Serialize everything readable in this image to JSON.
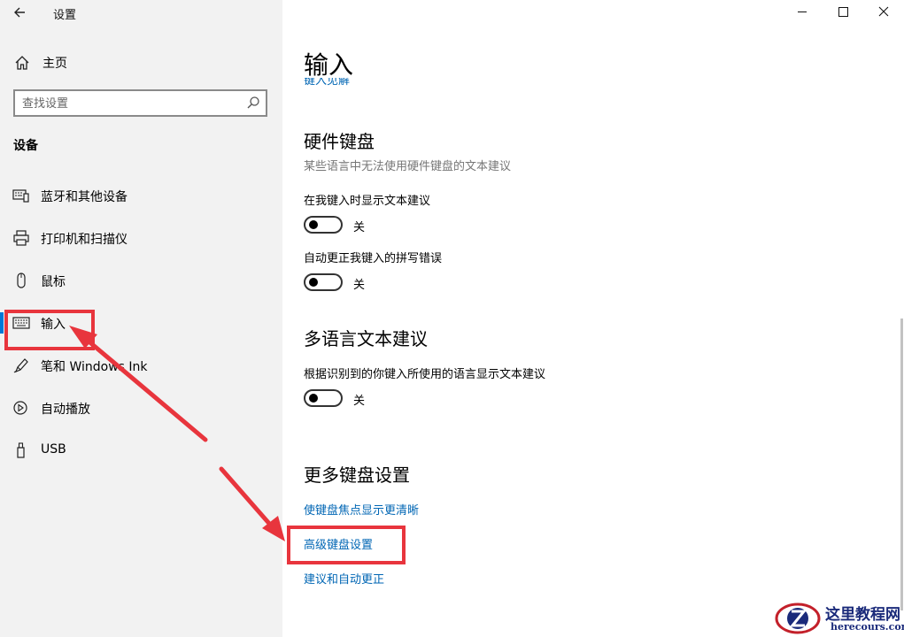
{
  "window": {
    "title": "设置",
    "controls": {
      "minimize": "minimize-icon",
      "maximize": "maximize-icon",
      "close": "close-icon"
    }
  },
  "sidebar": {
    "home_label": "主页",
    "search_placeholder": "查找设置",
    "section": "设备",
    "items": [
      {
        "label": "蓝牙和其他设备",
        "icon": "bluetooth-devices-icon"
      },
      {
        "label": "打印机和扫描仪",
        "icon": "printer-icon"
      },
      {
        "label": "鼠标",
        "icon": "mouse-icon"
      },
      {
        "label": "输入",
        "icon": "keyboard-icon",
        "active": true
      },
      {
        "label": "笔和 Windows Ink",
        "icon": "pen-icon"
      },
      {
        "label": "自动播放",
        "icon": "autoplay-icon"
      },
      {
        "label": "USB",
        "icon": "usb-icon"
      }
    ]
  },
  "main": {
    "title": "输入",
    "cut_link": "键入见解",
    "hardware_keyboard": {
      "heading": "硬件键盘",
      "description": "某些语言中无法使用硬件键盘的文本建议",
      "settings": [
        {
          "label": "在我键入时显示文本建议",
          "state": "关"
        },
        {
          "label": "自动更正我键入的拼写错误",
          "state": "关"
        }
      ]
    },
    "multilingual": {
      "heading": "多语言文本建议",
      "settings": [
        {
          "label": "根据识别到的你键入所使用的语言显示文本建议",
          "state": "关"
        }
      ]
    },
    "more_keyboard": {
      "heading": "更多键盘设置",
      "links": [
        "使键盘焦点显示更清晰",
        "高级键盘设置",
        "建议和自动更正"
      ]
    }
  },
  "annotation_color": "#e8353d",
  "accent_color": "#0078d7",
  "link_color": "#0066b4",
  "watermark": {
    "title": "这里教程网",
    "url": "herecours.com"
  }
}
